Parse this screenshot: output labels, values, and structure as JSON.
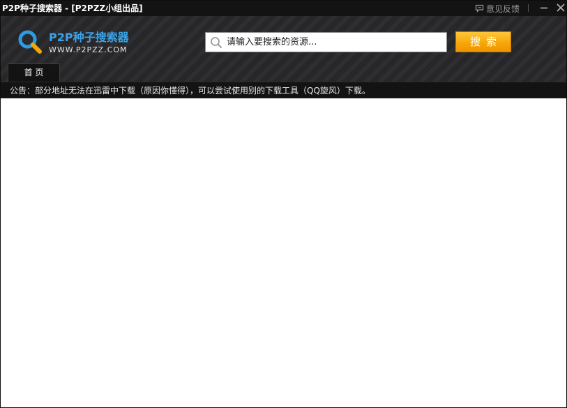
{
  "window": {
    "title": "P2P种子搜索器 - [P2PZZ小组出品]",
    "feedback_label": "意见反馈",
    "feedback_icon": "chat-bubble-icon",
    "minimize_icon": "minimize-icon",
    "close_icon": "close-icon"
  },
  "brand": {
    "name": "P2P种子搜索器",
    "url": "WWW.P2PZZ.COM",
    "logo_icon": "magnifier-logo-icon",
    "accent_color": "#3aa3e8"
  },
  "search": {
    "placeholder": "请输入要搜索的资源...",
    "value": "",
    "button_label": "搜索",
    "button_color": "#f7a70b",
    "icon": "search-icon"
  },
  "tabs": [
    {
      "label": "首 页",
      "active": true
    }
  ],
  "notice": {
    "text": "公告：部分地址无法在迅雷中下载（原因你懂得），可以尝试使用别的下载工具（QQ旋风）下载。"
  }
}
